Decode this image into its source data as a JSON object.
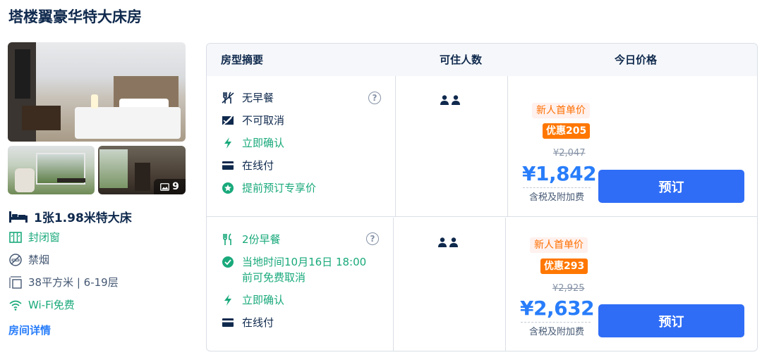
{
  "room": {
    "title": "塔楼翼豪华特大床房",
    "photo_count": "9",
    "bed": "1张1.98米特大床",
    "facts": [
      {
        "icon": "window-icon",
        "text": "封闭窗"
      },
      {
        "icon": "no-smoking-icon",
        "text": "禁烟"
      },
      {
        "icon": "area-icon",
        "text": "38平方米 | 6-19层"
      },
      {
        "icon": "wifi-icon",
        "text": "Wi-Fi免费"
      }
    ],
    "detail_link": "房间详情"
  },
  "table": {
    "headers": {
      "summary": "房型摘要",
      "guests": "可住人数",
      "price": "今日价格"
    }
  },
  "offers": [
    {
      "features": [
        {
          "icon": "no-breakfast-icon",
          "text": "无早餐",
          "green": false
        },
        {
          "icon": "no-cancel-icon",
          "text": "不可取消",
          "green": false
        },
        {
          "icon": "lightning-icon",
          "text": "立即确认",
          "green": true
        },
        {
          "icon": "card-icon",
          "text": "在线付",
          "green": false
        },
        {
          "icon": "star-badge-icon",
          "text": "提前预订专享价",
          "green": true
        }
      ],
      "guests": 2,
      "promo_label": "新人首单价",
      "discount": "优惠205",
      "original_price": "¥2,047",
      "price": "¥1,842",
      "tax_note": "含税及附加费",
      "book_label": "预订"
    },
    {
      "features": [
        {
          "icon": "breakfast-icon",
          "text": "2份早餐",
          "green": true
        },
        {
          "icon": "check-circle-icon",
          "text": "当地时间10月16日 18:00",
          "text2": "前可免费取消",
          "green": true
        },
        {
          "icon": "lightning-icon",
          "text": "立即确认",
          "green": true
        },
        {
          "icon": "card-icon",
          "text": "在线付",
          "green": false
        }
      ],
      "guests": 2,
      "promo_label": "新人首单价",
      "discount": "优惠293",
      "original_price": "¥2,925",
      "price": "¥2,632",
      "tax_note": "含税及附加费",
      "book_label": "预订"
    }
  ],
  "colors": {
    "accent": "#287dfa",
    "green": "#19a97b",
    "orange": "#ff7700",
    "text": "#0f294d"
  }
}
